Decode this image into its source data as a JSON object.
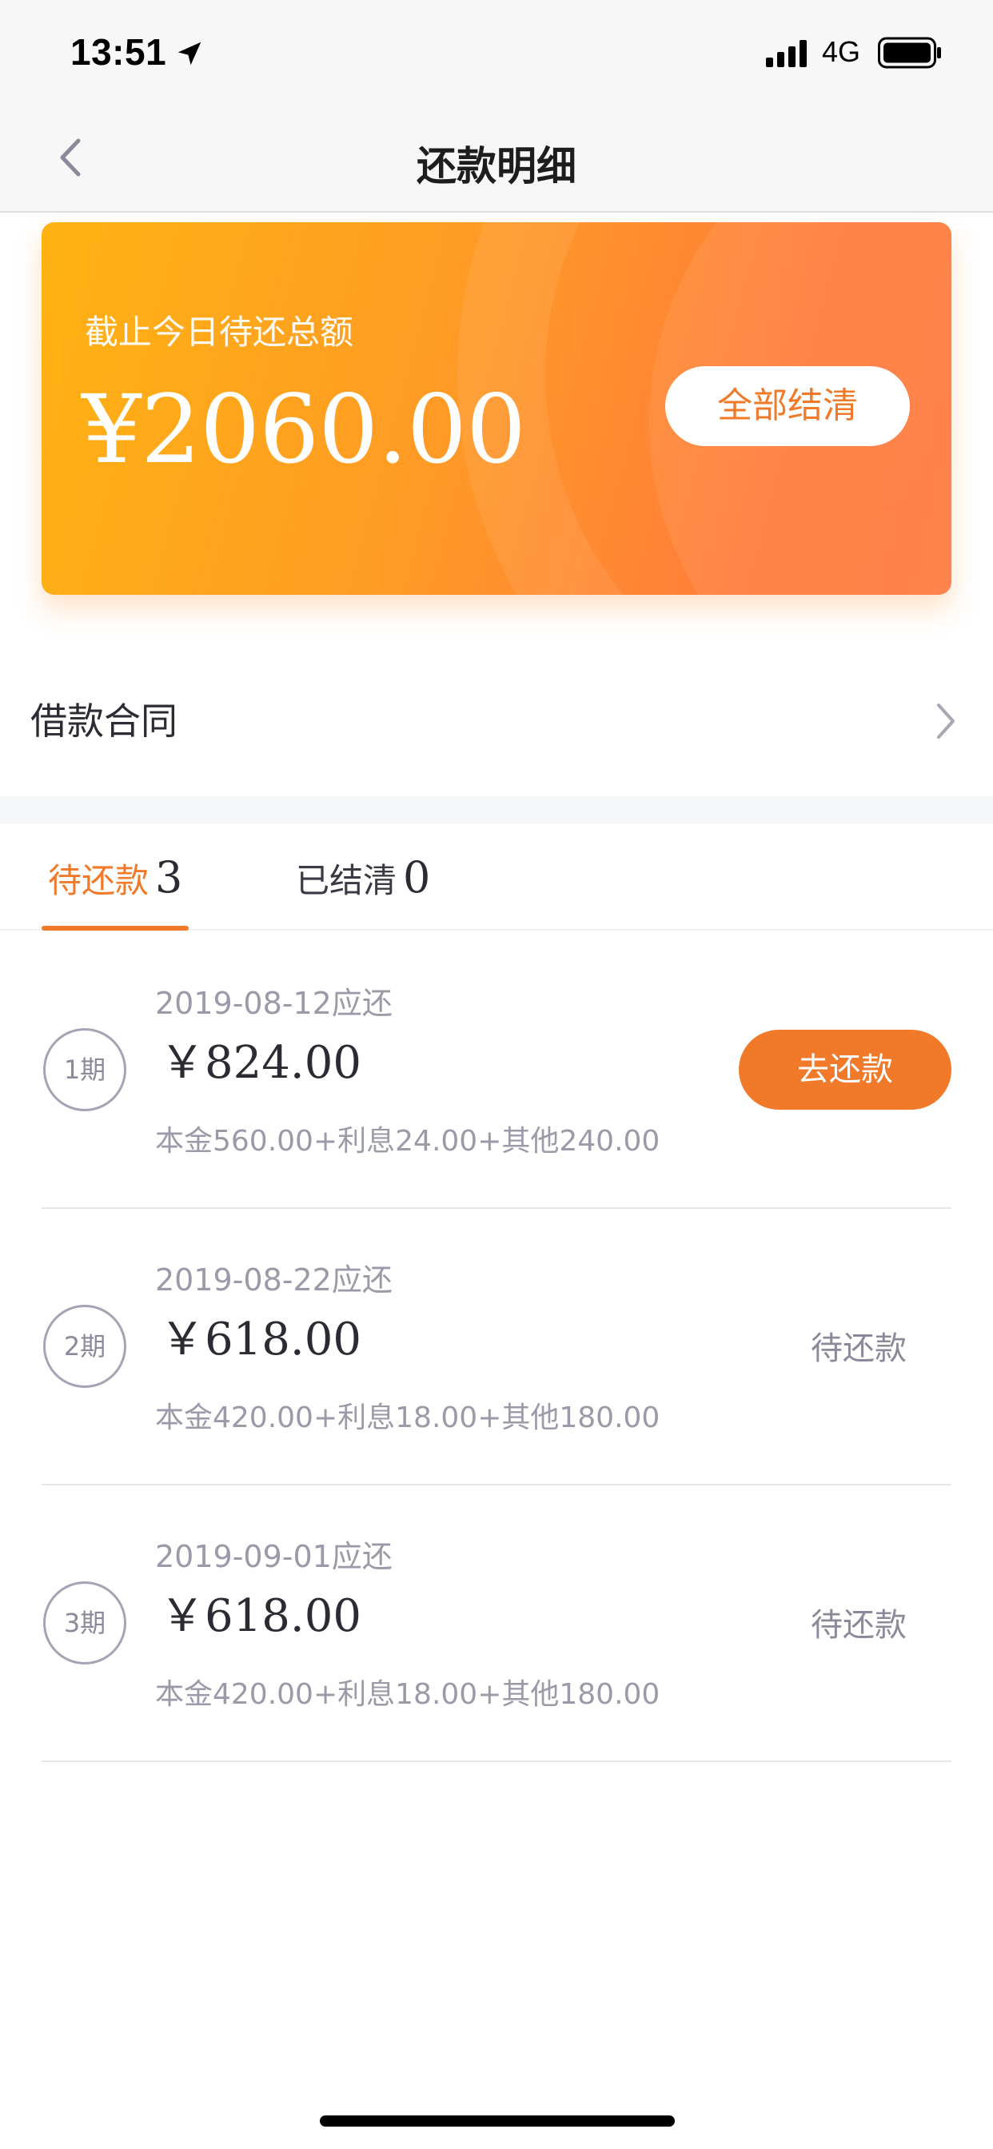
{
  "status_bar": {
    "time": "13:51",
    "network": "4G",
    "icons": [
      "location-arrow-icon",
      "signal-icon",
      "battery-icon"
    ]
  },
  "nav": {
    "title": "还款明细",
    "back_icon": "chevron-left-icon"
  },
  "summary": {
    "label": "截止今日待还总额",
    "amount": "¥2060.00",
    "settle_all_label": "全部结清"
  },
  "contract": {
    "label": "借款合同",
    "icon": "chevron-right-icon"
  },
  "tabs": [
    {
      "label": "待还款",
      "count": "3",
      "active": true
    },
    {
      "label": "已结清",
      "count": "0",
      "active": false
    }
  ],
  "installments": [
    {
      "period": "1期",
      "due_date": "2019-08-12应还",
      "amount": "￥824.00",
      "breakdown": "本金560.00+利息24.00+其他240.00",
      "action_label": "去还款",
      "status": ""
    },
    {
      "period": "2期",
      "due_date": "2019-08-22应还",
      "amount": "￥618.00",
      "breakdown": "本金420.00+利息18.00+其他180.00",
      "action_label": "",
      "status": "待还款"
    },
    {
      "period": "3期",
      "due_date": "2019-09-01应还",
      "amount": "￥618.00",
      "breakdown": "本金420.00+利息18.00+其他180.00",
      "action_label": "",
      "status": "待还款"
    }
  ],
  "colors": {
    "accent": "#f07a2a",
    "card_gradient_start": "#ffb312",
    "card_gradient_end": "#ff7a3f",
    "muted_text": "#9a9aa8"
  }
}
